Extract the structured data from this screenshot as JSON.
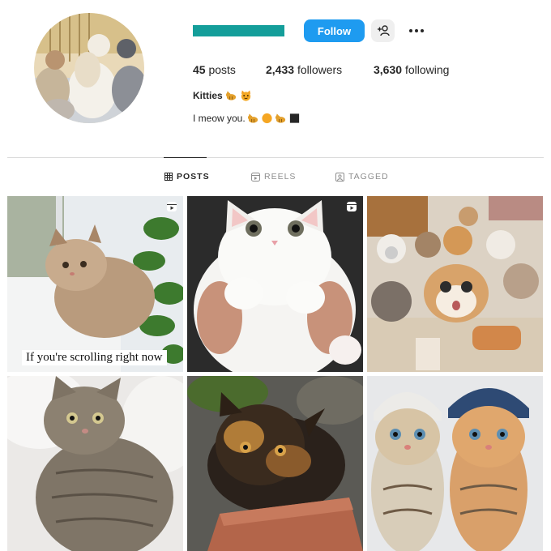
{
  "profile": {
    "avatar_icon": "profile-avatar-cats",
    "username_bar_color": "#149e9a",
    "follow_label": "Follow",
    "suggest_icon": "add-person-icon",
    "more_icon": "more-options-icon"
  },
  "stats": {
    "posts_count": "45",
    "posts_label": "posts",
    "followers_count": "2,433",
    "followers_label": "followers",
    "following_count": "3,630",
    "following_label": "following"
  },
  "bio": {
    "name": "Kitties",
    "name_emojis": [
      "cat-emoji",
      "cat-face-emoji"
    ],
    "text": "I meow you.",
    "text_emojis": [
      "cat-emoji",
      "orange-circle-emoji",
      "cat-emoji",
      "black-square-emoji"
    ]
  },
  "tabs": [
    {
      "label": "POSTS",
      "icon": "grid-icon",
      "active": true
    },
    {
      "label": "REELS",
      "icon": "reels-icon",
      "active": false
    },
    {
      "label": "TAGGED",
      "icon": "tagged-icon",
      "active": false
    }
  ],
  "posts": [
    {
      "subject": "fluffy kitten at window",
      "is_reel": true,
      "caption": "If you're scrolling right now"
    },
    {
      "subject": "white persian kitten held in hands",
      "is_reel": true,
      "caption": ""
    },
    {
      "subject": "group of cats selfie",
      "is_reel": false,
      "caption": ""
    },
    {
      "subject": "tabby cat in white bed",
      "is_reel": false,
      "caption": ""
    },
    {
      "subject": "tortoiseshell cat on brick",
      "is_reel": false,
      "caption": ""
    },
    {
      "subject": "two kittens in knit hats",
      "is_reel": false,
      "caption": ""
    }
  ],
  "colors": {
    "accent": "#1e9bf0",
    "text": "#262626",
    "muted": "#8e8e8e",
    "divider": "#dbdbdb"
  }
}
